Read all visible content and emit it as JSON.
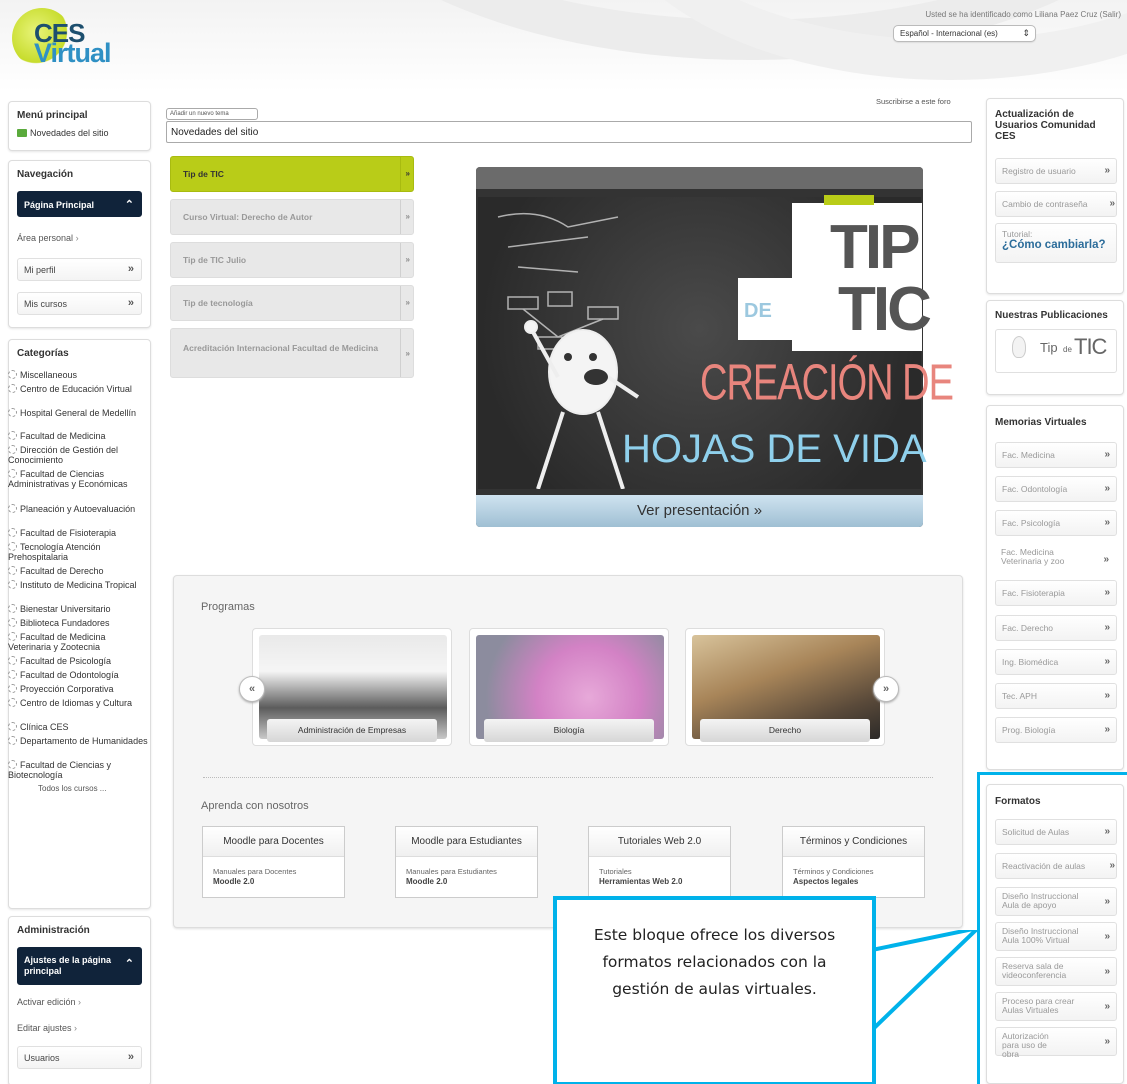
{
  "header": {
    "logo_line1": "CES",
    "logo_line2": "Virtual",
    "login_text": "Usted se ha identificado como Liliana Paez Cruz (Salir)",
    "language": "Español - Internacional (es)"
  },
  "menu_principal": {
    "title": "Menú principal",
    "item": "Novedades del sitio"
  },
  "navegacion": {
    "title": "Navegación",
    "items": [
      "Página Principal",
      "Área personal",
      "Mi perfil",
      "Mis cursos"
    ]
  },
  "categorias": {
    "title": "Categorías",
    "items": [
      "Miscellaneous",
      "Centro de Educación Virtual",
      "Hospital General de Medellín",
      "Facultad de Medicina",
      "Dirección de Gestión del Conocimiento",
      "Facultad de Ciencias Administrativas y Económicas",
      "Planeación y Autoevaluación",
      "Facultad de Fisioterapia",
      "Tecnología Atención Prehospitalaria",
      "Facultad de Derecho",
      "Instituto de Medicina Tropical",
      "Bienestar Universitario",
      "Biblioteca Fundadores",
      "Facultad de Medicina Veterinaria y Zootecnia",
      "Facultad de Psicología",
      "Facultad de Odontología",
      "Proyección Corporativa",
      "Centro de Idiomas y Cultura",
      "Clínica CES",
      "Departamento de Humanidades",
      "Facultad de Ciencias y Biotecnología"
    ],
    "all": "Todos los cursos ..."
  },
  "administracion": {
    "title": "Administración",
    "items": [
      "Ajustes de la página principal",
      "Activar edición",
      "Editar ajustes",
      "Usuarios"
    ]
  },
  "forum": {
    "new_topic": "Añadir un nuevo tema",
    "title": "Novedades del sitio",
    "subscribe": "Suscribirse a este foro"
  },
  "tabs": [
    "Tip de TIC",
    "Curso Virtual: Derecho de Autor",
    "Tip de TIC Julio",
    "Tip de tecnología",
    "Acreditación Internacional Facultad de Medicina"
  ],
  "slide": {
    "tip": "TIP",
    "de": "DE",
    "tic": "TIC",
    "line1": "CREACIÓN DE",
    "line2": "HOJAS DE VIDA",
    "button": "Ver presentación »"
  },
  "programas": {
    "title": "Programas",
    "prev": "«",
    "next": "»",
    "cards": [
      "Administración de Empresas",
      "Biología",
      "Derecho"
    ]
  },
  "aprenda": {
    "title": "Aprenda con nosotros",
    "cards": [
      {
        "head": "Moodle para Docentes",
        "l1": "Manuales para Docentes",
        "l2": "Moodle 2.0"
      },
      {
        "head": "Moodle para Estudiantes",
        "l1": "Manuales para Estudiantes",
        "l2": "Moodle 2.0"
      },
      {
        "head": "Tutoriales Web 2.0",
        "l1": "Tutoriales",
        "l2": "Herramientas Web 2.0"
      },
      {
        "head": "Términos y Condiciones",
        "l1": "Términos y Condiciones",
        "l2": "Aspectos legales"
      }
    ]
  },
  "actualizacion": {
    "title": "Actualización de Usuarios Comunidad CES",
    "items": [
      "Registro de usuario",
      "Cambio de contraseña"
    ],
    "tutorial_label": "Tutorial:",
    "tutorial_link": "¿Cómo cambiarla?"
  },
  "publicaciones": {
    "title": "Nuestras Publicaciones",
    "tip": "Tip",
    "de": "de",
    "tic": "TIC"
  },
  "memorias": {
    "title": "Memorias Virtuales",
    "items": [
      "Fac. Medicina",
      "Fac. Odontología",
      "Fac. Psicología",
      "Fac. Medicina Veterinaria y zoo",
      "Fac. Fisioterapia",
      "Fac. Derecho",
      "Ing. Biomédica",
      "Tec. APH",
      "Prog. Biología"
    ]
  },
  "formatos": {
    "title": "Formatos",
    "items": [
      "Solicitud de Aulas",
      "Reactivación de aulas",
      "Diseño Instruccional Aula de apoyo",
      "Diseño Instruccional Aula 100% Virtual",
      "Reserva sala de videoconferencia",
      "Proceso para crear Aulas Virtuales",
      "Autorización para uso de obra"
    ]
  },
  "callout": "Este bloque ofrece los diversos formatos relacionados con la gestión de aulas virtuales.",
  "colors": {
    "accent": "#b9cc18",
    "nav_dark": "#10233a",
    "callout": "#00b2ea"
  }
}
